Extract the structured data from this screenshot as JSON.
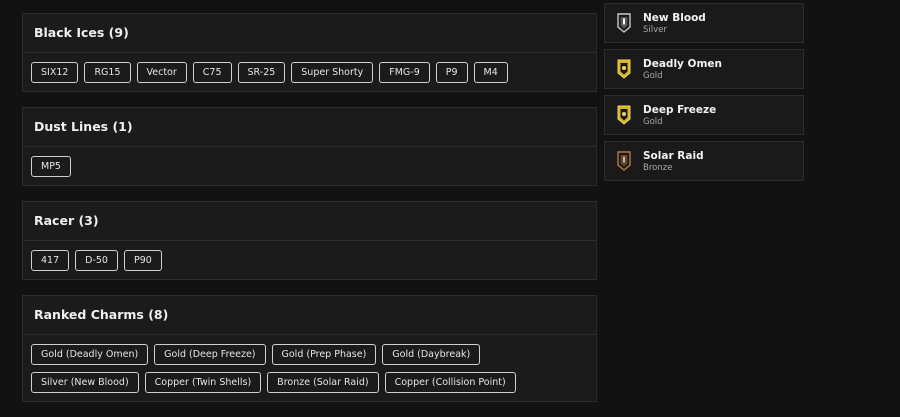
{
  "groups": [
    {
      "title": "Black Ices (9)",
      "items": [
        "SIX12",
        "RG15",
        "Vector",
        "C75",
        "SR-25",
        "Super Shorty",
        "FMG-9",
        "P9",
        "M4"
      ]
    },
    {
      "title": "Dust Lines (1)",
      "items": [
        "MP5"
      ]
    },
    {
      "title": "Racer (3)",
      "items": [
        "417",
        "D-50",
        "P90"
      ]
    },
    {
      "title": "Ranked Charms (8)",
      "items": [
        "Gold (Deadly Omen)",
        "Gold (Deep Freeze)",
        "Gold (Prep Phase)",
        "Gold (Daybreak)",
        "Silver (New Blood)",
        "Copper (Twin Shells)",
        "Bronze (Solar Raid)",
        "Copper (Collision Point)"
      ]
    }
  ],
  "ranks": [
    {
      "name": "New Blood",
      "tier": "Silver",
      "icon": "silver-rank-badge-icon",
      "color": "#c9c9c9"
    },
    {
      "name": "Deadly Omen",
      "tier": "Gold",
      "icon": "gold-rank-badge-icon",
      "color": "#d8b531"
    },
    {
      "name": "Deep Freeze",
      "tier": "Gold",
      "icon": "gold-rank-badge-icon",
      "color": "#d8b531"
    },
    {
      "name": "Solar Raid",
      "tier": "Bronze",
      "icon": "bronze-rank-badge-icon",
      "color": "#b07a45"
    }
  ]
}
